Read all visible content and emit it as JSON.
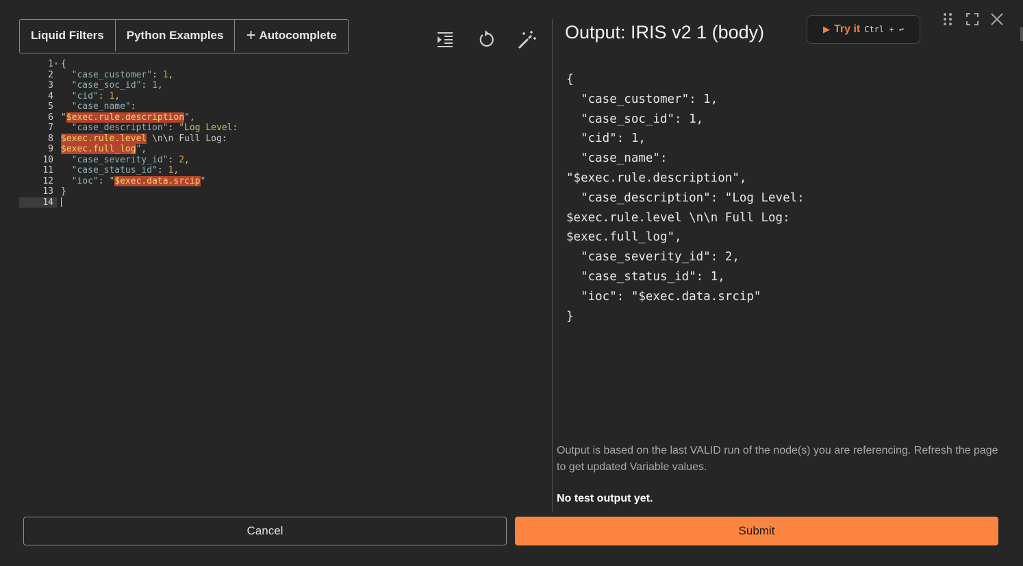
{
  "tabs": [
    {
      "label": "Liquid Filters"
    },
    {
      "label": "Python Examples"
    },
    {
      "label": "Autocomplete"
    }
  ],
  "code_lines": [
    [
      {
        "t": "{",
        "c": "p"
      }
    ],
    [
      {
        "t": "  ",
        "c": "p"
      },
      {
        "t": "\"case_customer\"",
        "c": "k"
      },
      {
        "t": ": ",
        "c": "p"
      },
      {
        "t": "1",
        "c": "n"
      },
      {
        "t": ",",
        "c": "s"
      }
    ],
    [
      {
        "t": "  ",
        "c": "p"
      },
      {
        "t": "\"case_soc_id\"",
        "c": "k"
      },
      {
        "t": ": ",
        "c": "p"
      },
      {
        "t": "1",
        "c": "n"
      },
      {
        "t": ",",
        "c": "s"
      }
    ],
    [
      {
        "t": "  ",
        "c": "p"
      },
      {
        "t": "\"cid\"",
        "c": "k"
      },
      {
        "t": ": ",
        "c": "p"
      },
      {
        "t": "1",
        "c": "n"
      },
      {
        "t": ",",
        "c": "s"
      }
    ],
    [
      {
        "t": "  ",
        "c": "p"
      },
      {
        "t": "\"case_name\"",
        "c": "k"
      },
      {
        "t": ":",
        "c": "p"
      }
    ],
    [
      {
        "t": "\"",
        "c": "s"
      },
      {
        "t": "$exec.rule.description",
        "c": "hl"
      },
      {
        "t": "\",",
        "c": "s"
      }
    ],
    [
      {
        "t": "  ",
        "c": "p"
      },
      {
        "t": "\"case_description\"",
        "c": "k"
      },
      {
        "t": ": ",
        "c": "p"
      },
      {
        "t": "\"Log Level:",
        "c": "s"
      }
    ],
    [
      {
        "t": "$exec.rule.level",
        "c": "hl"
      },
      {
        "t": " \\n\\n Full Log:",
        "c": "p"
      }
    ],
    [
      {
        "t": "$exec.full_log",
        "c": "hl"
      },
      {
        "t": "\",",
        "c": "s"
      }
    ],
    [
      {
        "t": "  ",
        "c": "p"
      },
      {
        "t": "\"case_severity_id\"",
        "c": "k"
      },
      {
        "t": ": ",
        "c": "p"
      },
      {
        "t": "2",
        "c": "n"
      },
      {
        "t": ",",
        "c": "s"
      }
    ],
    [
      {
        "t": "  ",
        "c": "p"
      },
      {
        "t": "\"case_status_id\"",
        "c": "k"
      },
      {
        "t": ": ",
        "c": "p"
      },
      {
        "t": "1",
        "c": "n"
      },
      {
        "t": ",",
        "c": "s"
      }
    ],
    [
      {
        "t": "  ",
        "c": "p"
      },
      {
        "t": "\"ioc\"",
        "c": "k"
      },
      {
        "t": ": ",
        "c": "p"
      },
      {
        "t": "\"",
        "c": "s"
      },
      {
        "t": "$exec.data.srcip",
        "c": "hl"
      },
      {
        "t": "\"",
        "c": "s"
      }
    ],
    [
      {
        "t": "}",
        "c": "p"
      }
    ],
    []
  ],
  "output": {
    "title": "Output: IRIS v2 1 (body)",
    "try_it": {
      "label": "Try it",
      "shortcut": "Ctrl + ↩"
    },
    "lines": [
      "{",
      "  \"case_customer\": 1,",
      "  \"case_soc_id\": 1,",
      "  \"cid\": 1,",
      "  \"case_name\":",
      "\"$exec.rule.description\",",
      "  \"case_description\": \"Log Level:",
      "$exec.rule.level \\n\\n Full Log:",
      "$exec.full_log\",",
      "  \"case_severity_id\": 2,",
      "  \"case_status_id\": 1,",
      "  \"ioc\": \"$exec.data.srcip\"",
      "}"
    ],
    "note": "Output is based on the last VALID run of the node(s) you are referencing. Refresh the page to get updated Variable values.",
    "status": "No test output yet."
  },
  "buttons": {
    "cancel": "Cancel",
    "submit": "Submit"
  },
  "colors": {
    "accent": "#fb8540",
    "background": "#262626",
    "highlight": "#b4442f"
  }
}
